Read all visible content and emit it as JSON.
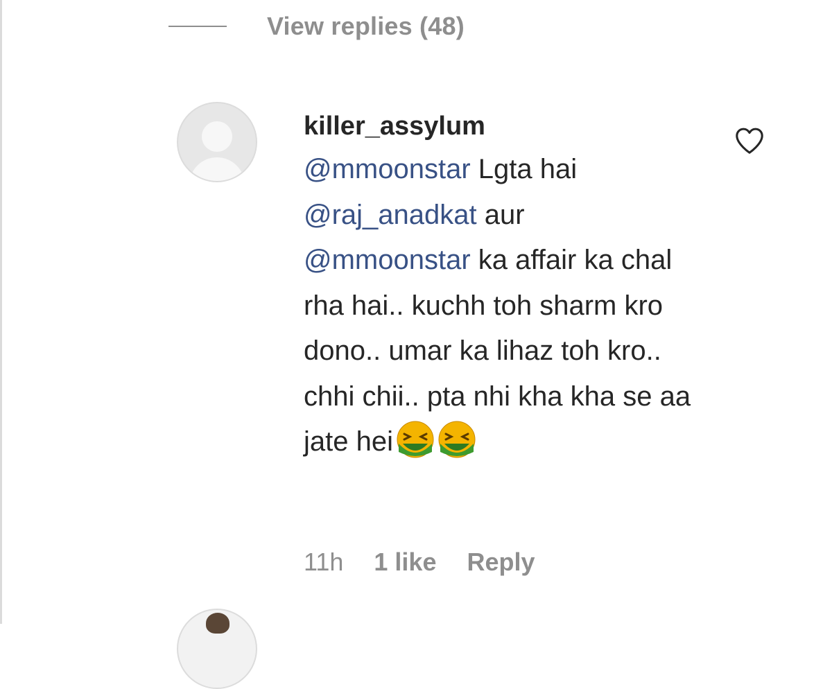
{
  "thread": {
    "view_replies_label": "View replies (48)"
  },
  "comment": {
    "username": "killer_assylum",
    "segments": [
      {
        "type": "mention",
        "text": "@mmoonstar"
      },
      {
        "type": "text",
        "text": " Lgta hai "
      },
      {
        "type": "mention",
        "text": "@raj_anadkat"
      },
      {
        "type": "text",
        "text": " aur "
      },
      {
        "type": "mention",
        "text": "@mmoonstar"
      },
      {
        "type": "text",
        "text": " ka affair ka chal rha hai.. kuchh toh sharm kro dono.. umar ka lihaz toh kro.. chhi chii.. pta nhi kha kha se aa jate hei"
      }
    ],
    "emojis": [
      "nauseated-face-emoji",
      "nauseated-face-emoji"
    ],
    "time": "11h",
    "likes": "1 like",
    "reply_label": "Reply",
    "like_icon": "heart-outline-icon"
  },
  "next_comment": {
    "username": ""
  },
  "colors": {
    "mention": "#385185",
    "muted": "#8e8e8e",
    "text": "#262626"
  }
}
